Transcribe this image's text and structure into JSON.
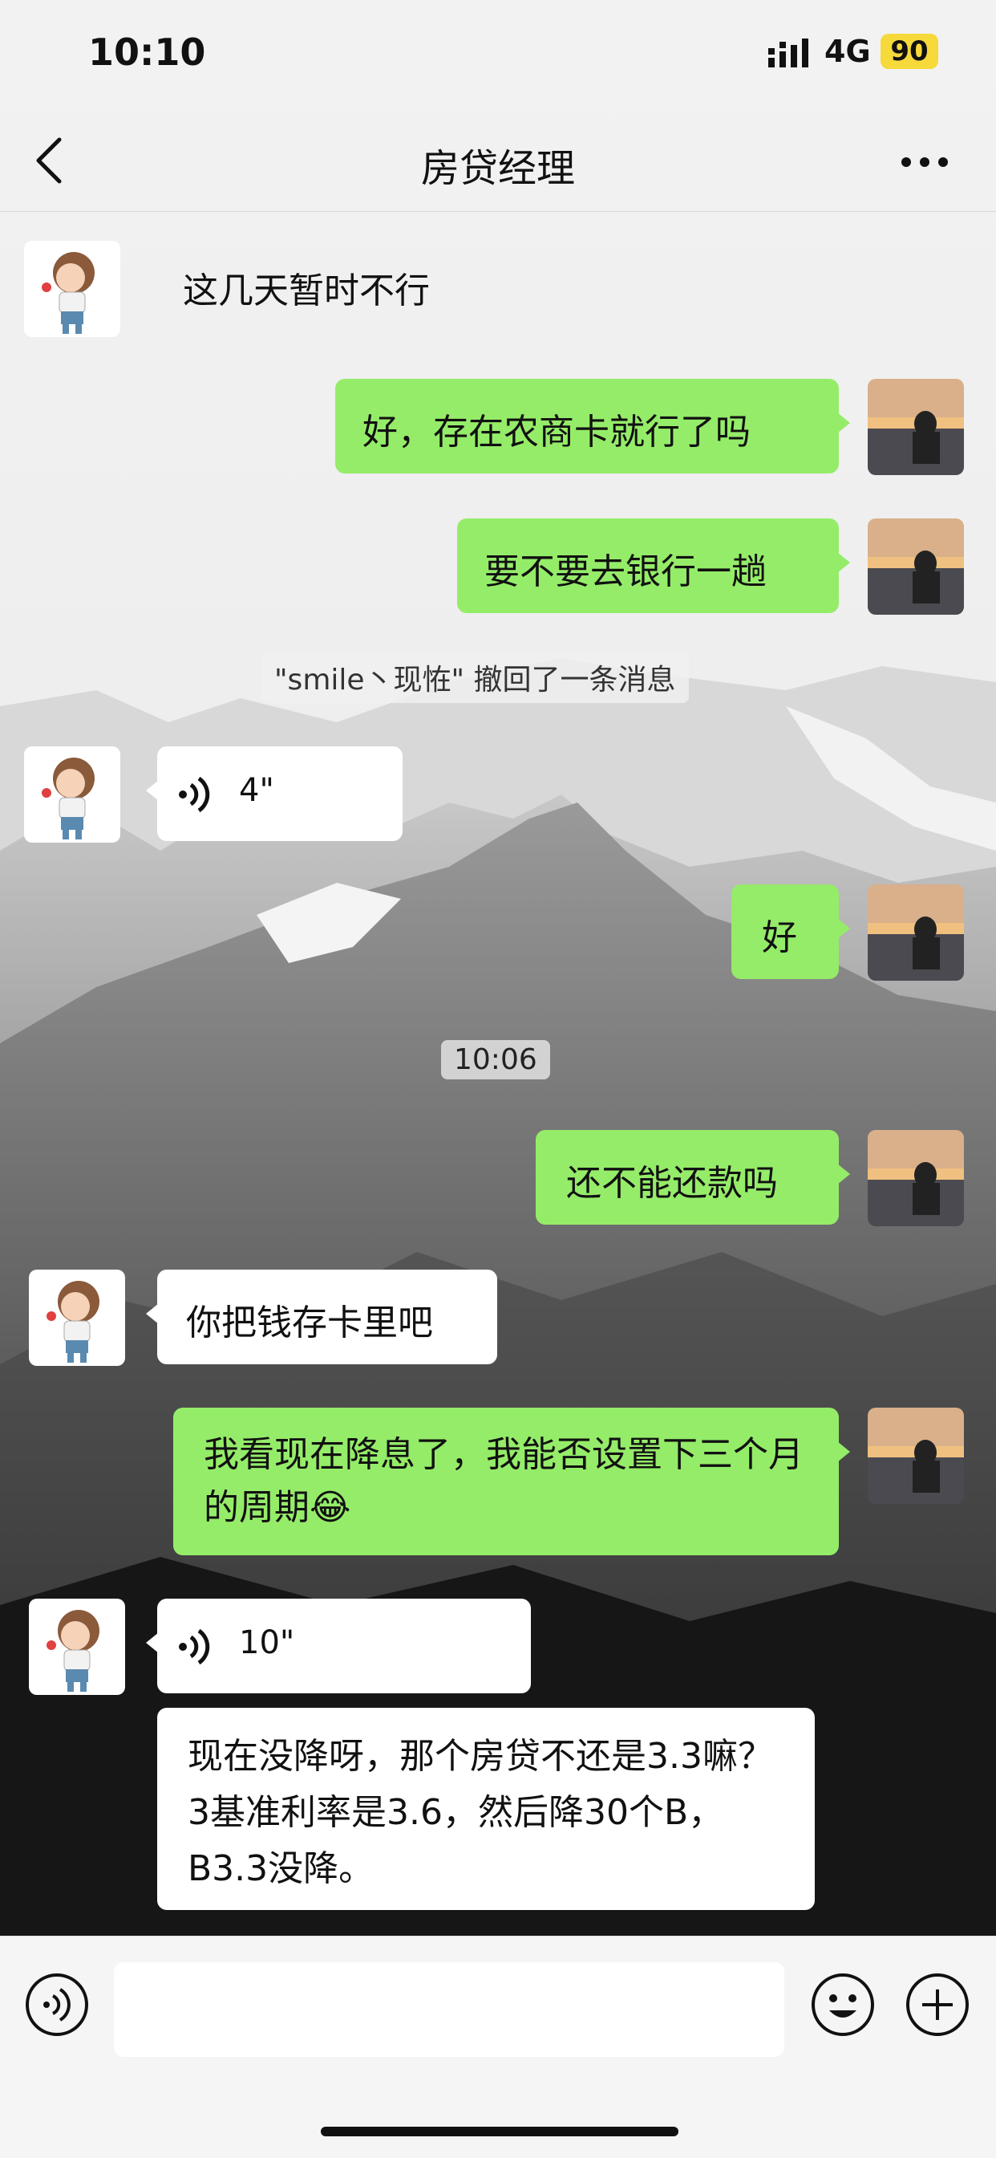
{
  "status_bar": {
    "time": "10:10",
    "network": "4G",
    "battery": "90"
  },
  "nav": {
    "title": "房贷经理"
  },
  "messages": [
    {
      "text": "这几天暂时不行"
    },
    {
      "text": "好，存在农商卡就行了吗"
    },
    {
      "text": "要不要去银行一趟"
    },
    {
      "text": "\"smile丶现恠\" 撤回了一条消息"
    },
    {
      "duration": "4\""
    },
    {
      "text": "好"
    },
    {
      "text": "10:06"
    },
    {
      "text": "还不能还款吗"
    },
    {
      "text": "你把钱存卡里吧"
    },
    {
      "text": "我看现在降息了，我能否设置下三个月的周期😂"
    },
    {
      "duration": "10\""
    },
    {
      "text": "现在没降呀，那个房贷不还是3.3嘛？3基准利率是3.6，然后降30个B，B3.3没降。"
    }
  ],
  "colors": {
    "sent_bubble": "#95ec69",
    "received_bubble": "#ffffff",
    "battery": "#f6d93a"
  }
}
